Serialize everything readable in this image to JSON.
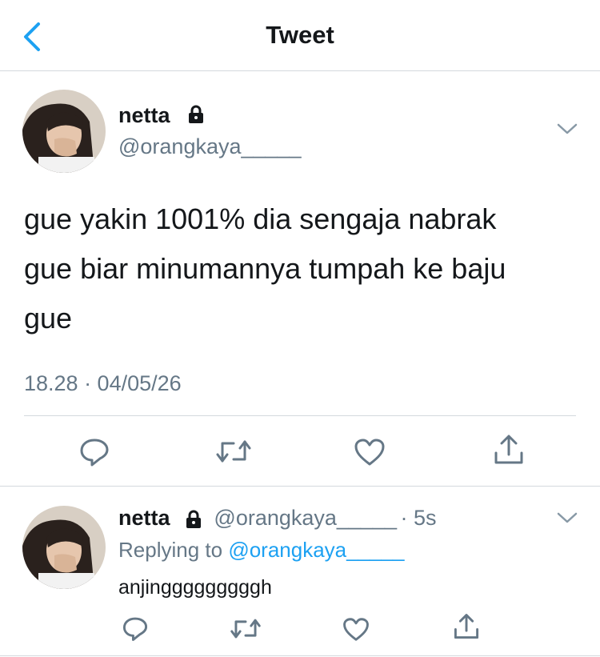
{
  "header": {
    "title": "Tweet",
    "back_icon": "chevron-left-icon"
  },
  "main_tweet": {
    "name": "netta",
    "handle": "@orangkaya_____",
    "text_lines": [
      "gue yakin 1001% dia sengaja nabrak",
      "gue biar minumannya tumpah ke baju",
      "gue"
    ],
    "timestamp": "18.28 · 04/05/26",
    "actions": [
      "reply-icon",
      "retweet-icon",
      "like-icon",
      "share-icon"
    ]
  },
  "reply_tweet": {
    "name": "netta",
    "handle": "@orangkaya_____",
    "age": "· 5s",
    "replying_prefix": "Replying to",
    "replying_handle": "@orangkaya_____",
    "text": "anjingggggggggh",
    "actions": [
      "reply-icon",
      "retweet-icon",
      "like-icon",
      "share-icon"
    ]
  },
  "colors": {
    "accent": "#1da1f2",
    "muted": "#657786",
    "text": "#14171a",
    "divider": "#d4d9dd"
  }
}
